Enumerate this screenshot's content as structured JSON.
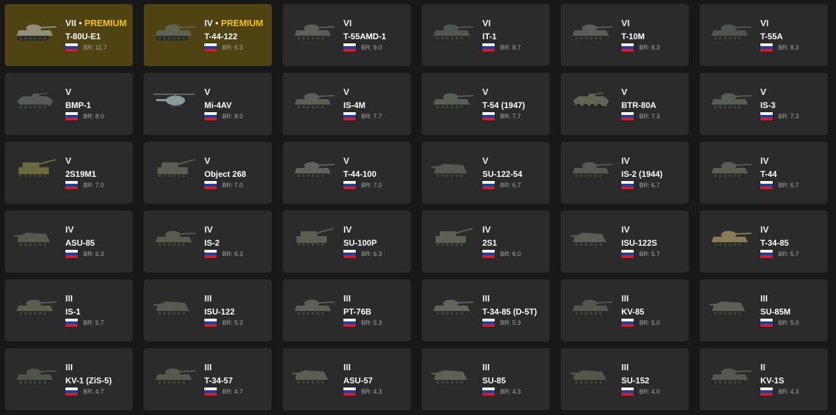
{
  "vehicles": [
    {
      "rank": "VII",
      "premium_label": "PREMIUM",
      "name": "T-80U-E1",
      "br": "BR: 11.7",
      "nation": "USSR",
      "premium": true,
      "kind": "tank",
      "color": "#8f8f7a"
    },
    {
      "rank": "IV",
      "premium_label": "PREMIUM",
      "name": "T-44-122",
      "br": "BR: 6.3",
      "nation": "USSR",
      "premium": true,
      "kind": "tank",
      "color": "#5d6450"
    },
    {
      "rank": "VI",
      "premium_label": "",
      "name": "T-55AMD-1",
      "br": "BR: 9.0",
      "nation": "USSR",
      "premium": false,
      "kind": "tank",
      "color": "#5b5f58"
    },
    {
      "rank": "VI",
      "premium_label": "",
      "name": "IT-1",
      "br": "BR: 8.7",
      "nation": "USSR",
      "premium": false,
      "kind": "tank",
      "color": "#505650"
    },
    {
      "rank": "VI",
      "premium_label": "",
      "name": "T-10M",
      "br": "BR: 8.3",
      "nation": "USSR",
      "premium": false,
      "kind": "tank",
      "color": "#5a5e58"
    },
    {
      "rank": "VI",
      "premium_label": "",
      "name": "T-55A",
      "br": "BR: 8.3",
      "nation": "USSR",
      "premium": false,
      "kind": "tank",
      "color": "#4e5450"
    },
    {
      "rank": "V",
      "premium_label": "",
      "name": "BMP-1",
      "br": "BR: 8.0",
      "nation": "USSR",
      "premium": false,
      "kind": "ifv",
      "color": "#55595a"
    },
    {
      "rank": "V",
      "premium_label": "",
      "name": "Mi-4AV",
      "br": "BR: 8.0",
      "nation": "USSR",
      "premium": false,
      "kind": "heli",
      "color": "#8b9a9c"
    },
    {
      "rank": "V",
      "premium_label": "",
      "name": "IS-4M",
      "br": "BR: 7.7",
      "nation": "USSR",
      "premium": false,
      "kind": "tank",
      "color": "#5a5e55"
    },
    {
      "rank": "V",
      "premium_label": "",
      "name": "T-54 (1947)",
      "br": "BR: 7.7",
      "nation": "USSR",
      "premium": false,
      "kind": "tank",
      "color": "#5a5f55"
    },
    {
      "rank": "V",
      "premium_label": "",
      "name": "BTR-80A",
      "br": "BR: 7.3",
      "nation": "USSR",
      "premium": false,
      "kind": "apc",
      "color": "#5f6655"
    },
    {
      "rank": "V",
      "premium_label": "",
      "name": "IS-3",
      "br": "BR: 7.3",
      "nation": "USSR",
      "premium": false,
      "kind": "tank",
      "color": "#585e55"
    },
    {
      "rank": "V",
      "premium_label": "",
      "name": "2S19M1",
      "br": "BR: 7.0",
      "nation": "USSR",
      "premium": false,
      "kind": "spg",
      "color": "#6b6a3c"
    },
    {
      "rank": "V",
      "premium_label": "",
      "name": "Object 268",
      "br": "BR: 7.0",
      "nation": "USSR",
      "premium": false,
      "kind": "spg",
      "color": "#5a5f53"
    },
    {
      "rank": "V",
      "premium_label": "",
      "name": "T-44-100",
      "br": "BR: 7.0",
      "nation": "USSR",
      "premium": false,
      "kind": "tank",
      "color": "#5f625a"
    },
    {
      "rank": "V",
      "premium_label": "",
      "name": "SU-122-54",
      "br": "BR: 6.7",
      "nation": "USSR",
      "premium": false,
      "kind": "td",
      "color": "#54574f"
    },
    {
      "rank": "IV",
      "premium_label": "",
      "name": "IS-2 (1944)",
      "br": "BR: 6.7",
      "nation": "USSR",
      "premium": false,
      "kind": "tank",
      "color": "#555a50"
    },
    {
      "rank": "IV",
      "premium_label": "",
      "name": "T-44",
      "br": "BR: 6.7",
      "nation": "USSR",
      "premium": false,
      "kind": "tank",
      "color": "#585c52"
    },
    {
      "rank": "IV",
      "premium_label": "",
      "name": "ASU-85",
      "br": "BR: 6.3",
      "nation": "USSR",
      "premium": false,
      "kind": "td",
      "color": "#54594b"
    },
    {
      "rank": "IV",
      "premium_label": "",
      "name": "IS-2",
      "br": "BR: 6.3",
      "nation": "USSR",
      "premium": false,
      "kind": "tank",
      "color": "#575c4e"
    },
    {
      "rank": "IV",
      "premium_label": "",
      "name": "SU-100P",
      "br": "BR: 6.3",
      "nation": "USSR",
      "premium": false,
      "kind": "spg",
      "color": "#5a5e50"
    },
    {
      "rank": "IV",
      "premium_label": "",
      "name": "2S1",
      "br": "BR: 6.0",
      "nation": "USSR",
      "premium": false,
      "kind": "spg",
      "color": "#5a6152"
    },
    {
      "rank": "IV",
      "premium_label": "",
      "name": "ISU-122S",
      "br": "BR: 5.7",
      "nation": "USSR",
      "premium": false,
      "kind": "td",
      "color": "#595d55"
    },
    {
      "rank": "IV",
      "premium_label": "",
      "name": "T-34-85",
      "br": "BR: 5.7",
      "nation": "USSR",
      "premium": false,
      "kind": "tank",
      "color": "#8a7a55"
    },
    {
      "rank": "III",
      "premium_label": "",
      "name": "IS-1",
      "br": "BR: 5.7",
      "nation": "USSR",
      "premium": false,
      "kind": "tank",
      "color": "#5a5f52"
    },
    {
      "rank": "III",
      "premium_label": "",
      "name": "ISU-122",
      "br": "BR: 5.3",
      "nation": "USSR",
      "premium": false,
      "kind": "td",
      "color": "#565b52"
    },
    {
      "rank": "III",
      "premium_label": "",
      "name": "PT-76B",
      "br": "BR: 5.3",
      "nation": "USSR",
      "premium": false,
      "kind": "tank",
      "color": "#5d6055"
    },
    {
      "rank": "III",
      "premium_label": "",
      "name": "T-34-85 (D-5T)",
      "br": "BR: 5.3",
      "nation": "USSR",
      "premium": false,
      "kind": "tank",
      "color": "#62665a"
    },
    {
      "rank": "III",
      "premium_label": "",
      "name": "KV-85",
      "br": "BR: 5.0",
      "nation": "USSR",
      "premium": false,
      "kind": "tank",
      "color": "#52574d"
    },
    {
      "rank": "III",
      "premium_label": "",
      "name": "SU-85M",
      "br": "BR: 5.0",
      "nation": "USSR",
      "premium": false,
      "kind": "td",
      "color": "#5d5f55"
    },
    {
      "rank": "III",
      "premium_label": "",
      "name": "KV-1 (ZiS-5)",
      "br": "BR: 4.7",
      "nation": "USSR",
      "premium": false,
      "kind": "tank",
      "color": "#4f5449"
    },
    {
      "rank": "III",
      "premium_label": "",
      "name": "T-34-57",
      "br": "BR: 4.7",
      "nation": "USSR",
      "premium": false,
      "kind": "tank",
      "color": "#555a4d"
    },
    {
      "rank": "III",
      "premium_label": "",
      "name": "ASU-57",
      "br": "BR: 4.3",
      "nation": "USSR",
      "premium": false,
      "kind": "td",
      "color": "#5a5d52"
    },
    {
      "rank": "III",
      "premium_label": "",
      "name": "SU-85",
      "br": "BR: 4.3",
      "nation": "USSR",
      "premium": false,
      "kind": "td",
      "color": "#5d6054"
    },
    {
      "rank": "III",
      "premium_label": "",
      "name": "SU-152",
      "br": "BR: 4.0",
      "nation": "USSR",
      "premium": false,
      "kind": "td",
      "color": "#52574c"
    },
    {
      "rank": "II",
      "premium_label": "",
      "name": "KV-1S",
      "br": "BR: 4.3",
      "nation": "USSR",
      "premium": false,
      "kind": "tank",
      "color": "#54594f"
    }
  ]
}
